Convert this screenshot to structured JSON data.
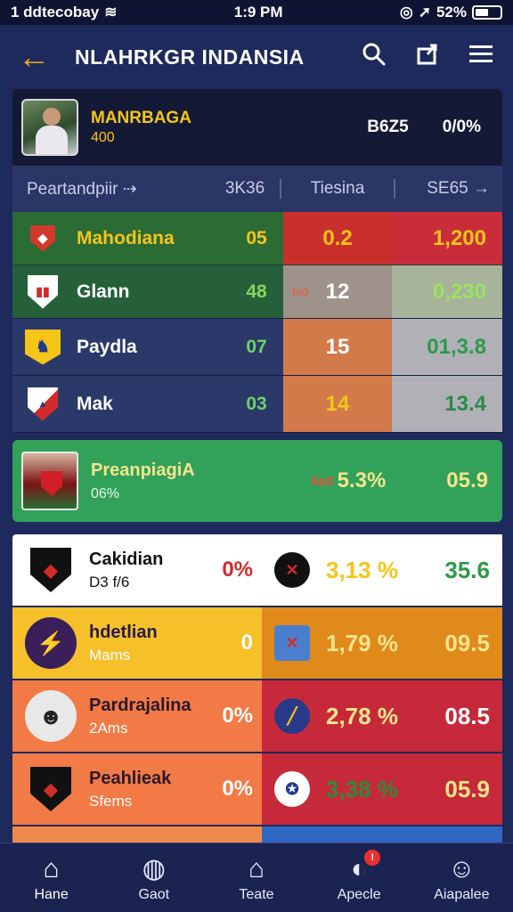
{
  "status": {
    "carrier": "1 ddtecobay",
    "time": "1:9 PM",
    "battery": "52%"
  },
  "appbar": {
    "title": "NLAHRKGR INDANSIA"
  },
  "featured": {
    "name": "MANRBAGA",
    "sub": "400",
    "stat1": "B6Z5",
    "stat2": "0/0%"
  },
  "columns": {
    "c1": "Peartandpiir",
    "c2": "3K36",
    "c3": "Tiesina",
    "c4": "SE65"
  },
  "rows": [
    {
      "name": "Mahodiana",
      "num": "05",
      "mid": "0.2",
      "tag": "",
      "right": "1,200"
    },
    {
      "name": "Glann",
      "num": "48",
      "mid": "12",
      "tag": "fa0",
      "right": "0,230"
    },
    {
      "name": "Paydla",
      "num": "07",
      "mid": "15",
      "tag": "",
      "right": "01,3.8"
    },
    {
      "name": "Mak",
      "num": "03",
      "mid": "14",
      "tag": "",
      "right": "13.4"
    }
  ],
  "highlight": {
    "name": "PreanpiagiA",
    "sub": "06%",
    "tag": "6a0",
    "pct": "5.3%",
    "val": "05.9"
  },
  "cards": [
    {
      "title": "Cakidian",
      "sub": "D3 f/6",
      "pct": "0%",
      "rpct": "3,13 %",
      "rval": "35.6"
    },
    {
      "title": "hdetlian",
      "sub": "Mams",
      "pct": "0",
      "rpct": "1,79 %",
      "rval": "09.5"
    },
    {
      "title": "Pardrajalina",
      "sub": "2Ams",
      "pct": "0%",
      "rpct": "2,78 %",
      "rval": "08.5"
    },
    {
      "title": "Peahlieak",
      "sub": "Sfems",
      "pct": "0%",
      "rpct": "3,38 %",
      "rval": "05.9"
    }
  ],
  "nav": [
    {
      "label": "Hane",
      "icon": "home-icon"
    },
    {
      "label": "Gaot",
      "icon": "tickets-icon"
    },
    {
      "label": "Teate",
      "icon": "house-outline-icon"
    },
    {
      "label": "Apecle",
      "icon": "globe-icon",
      "badge": "!"
    },
    {
      "label": "Aiapalee",
      "icon": "profile-icon"
    }
  ]
}
